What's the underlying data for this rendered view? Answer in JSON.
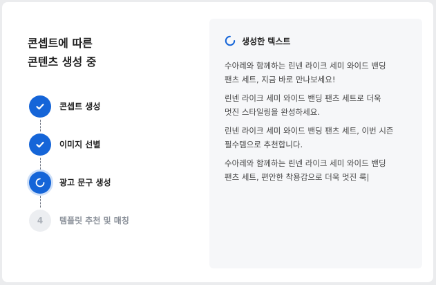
{
  "header": {
    "title_lines": [
      "콘셉트에 따른",
      "콘텐츠 생성 중"
    ]
  },
  "steps": [
    {
      "label": "콘셉트 생성",
      "status": "done",
      "icon": "check-icon"
    },
    {
      "label": "이미지 선별",
      "status": "done",
      "icon": "check-icon"
    },
    {
      "label": "광고 문구 생성",
      "status": "active",
      "icon": "spinner-icon"
    },
    {
      "label": "템플릿 추천 및 매칭",
      "status": "pending",
      "number": "4"
    }
  ],
  "panel": {
    "title": "생성한 텍스트",
    "icon": "spinner-icon",
    "paragraphs": [
      [
        "수아레와 함께하는 린넨 라이크 세미 와이드 밴딩",
        "팬츠 세트, 지금 바로 만나보세요!"
      ],
      [
        "린넨 라이크 세미 와이드 밴딩 팬츠 세트로 더욱",
        "멋진 스타일링을 완성하세요."
      ],
      [
        "린넨 라이크 세미 와이드 밴딩 팬츠 세트, 이번 시즌",
        "필수템으로 추천합니다."
      ],
      [
        "수아레와 함께하는 린넨 라이크 세미 와이드 밴딩",
        "팬츠 세트, 편안한 착용감으로 더욱 멋진 룩|"
      ]
    ]
  },
  "colors": {
    "accent": "#1565d8",
    "panel_bg": "#f6f7f9",
    "page_bg": "#ebecee",
    "pending": "#eceef1"
  }
}
